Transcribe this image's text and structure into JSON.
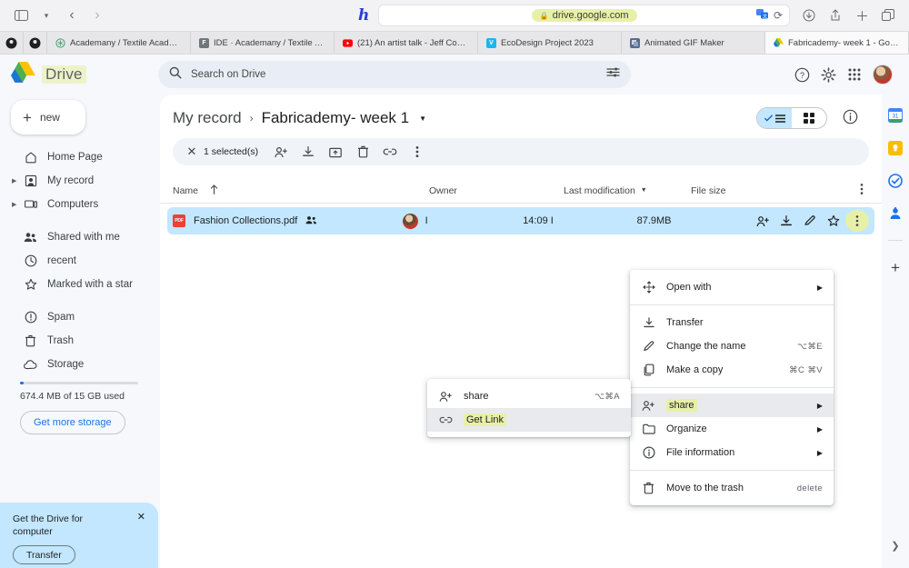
{
  "browser": {
    "url": "drive.google.com",
    "lock_icon": "lock-icon",
    "back_icon": "back-arrow-icon",
    "forward_icon": "forward-arrow-icon",
    "sidebar_icon": "sidebar-toggle-icon",
    "dropdown_icon": "chevron-down-icon",
    "extension_icon": "hypothesis-icon",
    "translate_icon": "translate-icon",
    "reload_icon": "reload-icon",
    "download_icon": "download-icon",
    "share_icon": "share-icon",
    "newtab_icon": "plus-icon",
    "tabs_icon": "tab-overview-icon",
    "tabs": [
      {
        "label": "Academany / Textile Academ...",
        "favicon": "fabacademy-icon",
        "active": false
      },
      {
        "label": "IDE · Academany / Textile Ac...",
        "favicon": "gitlab-icon",
        "active": false
      },
      {
        "label": "(21) An artist talk - Jeff Cowe...",
        "favicon": "youtube-icon",
        "active": false
      },
      {
        "label": "EcoDesign Project 2023",
        "favicon": "vimeo-icon",
        "active": false
      },
      {
        "label": "Animated GIF Maker",
        "favicon": "gif-maker-icon",
        "active": false
      },
      {
        "label": "Fabricademy- week 1 - Googl...",
        "favicon": "drive-icon",
        "active": true
      }
    ]
  },
  "drive": {
    "brand": "Drive",
    "search": {
      "placeholder": "Search on Drive",
      "search_icon": "search-icon",
      "filter_icon": "tune-icon"
    },
    "header_icons": [
      "help-icon",
      "settings-icon",
      "apps-grid-icon"
    ],
    "new_button": "new",
    "nav": [
      {
        "label": "Home Page",
        "icon": "home-icon",
        "expandable": false
      },
      {
        "label": "My record",
        "icon": "my-drive-icon",
        "expandable": true
      },
      {
        "label": "Computers",
        "icon": "computer-icon",
        "expandable": true
      },
      {
        "label": "Shared with me",
        "icon": "shared-icon",
        "expandable": false
      },
      {
        "label": "recent",
        "icon": "clock-icon",
        "expandable": false
      },
      {
        "label": "Marked with a star",
        "icon": "star-icon",
        "expandable": false
      },
      {
        "label": "Spam",
        "icon": "spam-icon",
        "expandable": false
      },
      {
        "label": "Trash",
        "icon": "trash-icon",
        "expandable": false
      },
      {
        "label": "Storage",
        "icon": "cloud-icon",
        "expandable": false
      }
    ],
    "storage": {
      "text": "674.4 MB of 15 GB used",
      "button": "Get more storage",
      "percent": 4.5
    },
    "promo": {
      "title": "Get the Drive for computer",
      "button": "Transfer",
      "close_icon": "close-icon"
    },
    "breadcrumb": {
      "root": "My record",
      "current": "Fabricademy- week 1",
      "separator": "›",
      "caret": "chevron-down-icon"
    },
    "view_toggle": {
      "list_icon": "list-view-icon",
      "grid_icon": "grid-view-icon",
      "selected": "list"
    },
    "info_icon": "info-icon",
    "selection_bar": {
      "close_icon": "close-icon",
      "count": "1 selected(s)",
      "actions": [
        "person-add-icon",
        "download-icon",
        "move-to-folder-icon",
        "trash-icon",
        "link-icon",
        "more-vert-icon"
      ]
    },
    "table": {
      "columns": [
        {
          "label": "Name",
          "sort_icon": "arrow-up-icon"
        },
        {
          "label": "Owner",
          "sort_icon": ""
        },
        {
          "label": "Last modification",
          "sort_icon": "chevron-down-icon"
        },
        {
          "label": "File size",
          "sort_icon": ""
        }
      ],
      "column_menu_icon": "more-vert-icon",
      "rows": [
        {
          "name": "Fashion Collections.pdf",
          "type_icon": "pdf-icon",
          "shared_icon": "people-icon",
          "owner": "I",
          "owner_avatar": "avatar",
          "modified": "14:09 I",
          "size": "87.9MB",
          "actions": [
            "person-add-icon",
            "download-icon",
            "edit-icon",
            "star-icon",
            "more-vert-icon"
          ],
          "selected": true
        }
      ]
    },
    "context_menu": [
      {
        "label": "Open with",
        "icon": "open-with-icon",
        "shortcut": "",
        "arrow": true,
        "separator_after": true
      },
      {
        "label": "Transfer",
        "icon": "download-icon",
        "shortcut": "",
        "arrow": false
      },
      {
        "label": "Change the name",
        "icon": "edit-icon",
        "shortcut": "⌥⌘E",
        "arrow": false
      },
      {
        "label": "Make a copy",
        "icon": "copy-icon",
        "shortcut": "⌘C ⌘V",
        "arrow": false,
        "separator_after": true
      },
      {
        "label": "share",
        "icon": "person-add-icon",
        "shortcut": "",
        "arrow": true,
        "hovered": true,
        "highlighted": true
      },
      {
        "label": "Organize",
        "icon": "folder-icon",
        "shortcut": "",
        "arrow": true
      },
      {
        "label": "File information",
        "icon": "info-icon",
        "shortcut": "",
        "arrow": true,
        "separator_after": true
      },
      {
        "label": "Move to the trash",
        "icon": "trash-icon",
        "shortcut": "delete",
        "arrow": false
      }
    ],
    "submenu": [
      {
        "label": "share",
        "icon": "person-add-icon",
        "shortcut": "⌥⌘A",
        "hovered": false,
        "highlighted": false
      },
      {
        "label": "Get Link",
        "icon": "link-icon",
        "shortcut": "",
        "hovered": true,
        "highlighted": true
      }
    ],
    "right_rail": {
      "items": [
        "calendar-icon",
        "keep-icon",
        "tasks-icon",
        "contacts-icon"
      ],
      "add_icon": "plus-icon",
      "expand_icon": "chevron-right-icon"
    }
  }
}
